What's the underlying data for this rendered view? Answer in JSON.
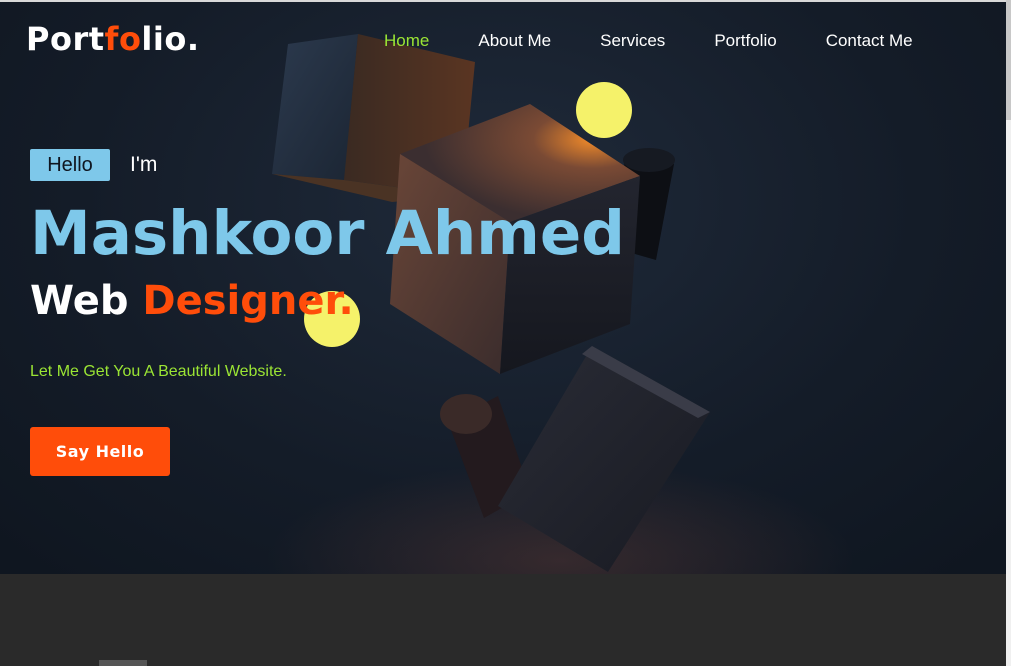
{
  "header": {
    "logo_pre": "Port",
    "logo_accent": "fo",
    "logo_post": "lio.",
    "nav": [
      {
        "label": "Home",
        "active": true
      },
      {
        "label": "About Me",
        "active": false
      },
      {
        "label": "Services",
        "active": false
      },
      {
        "label": "Portfolio",
        "active": false
      },
      {
        "label": "Contact Me",
        "active": false
      }
    ]
  },
  "hero": {
    "hello_badge": "Hello",
    "im": "I'm",
    "name": "Mashkoor Ahmed",
    "role_prefix": "Web",
    "role_highlight": "Designer",
    "role_dot": ".",
    "tagline": "Let Me Get You A Beautiful Website.",
    "cta_label": "Say Hello"
  },
  "colors": {
    "accent_orange": "#ff4d0a",
    "accent_blue": "#7ec8ea",
    "accent_green": "#9be534",
    "dot_yellow": "#f5f26a",
    "hero_bg": "#141c28"
  }
}
